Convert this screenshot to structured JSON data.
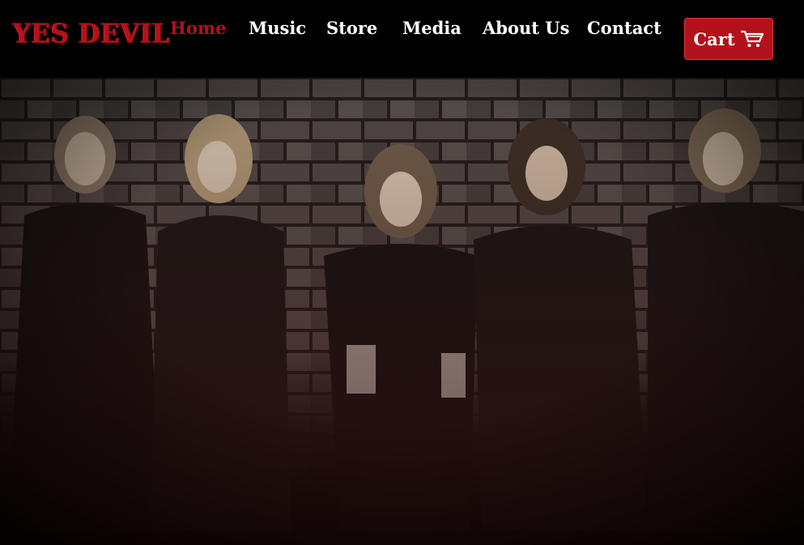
{
  "brand": {
    "name": "YES DEVIL"
  },
  "nav": {
    "items": [
      {
        "label": "Home",
        "active": true
      },
      {
        "label": "Music",
        "active": false
      },
      {
        "label": "Store",
        "active": false
      },
      {
        "label": "Media",
        "active": false
      },
      {
        "label": "About Us",
        "active": false
      },
      {
        "label": "Contact",
        "active": false
      }
    ]
  },
  "cart": {
    "label": "Cart",
    "icon": "shopping-cart-icon"
  },
  "hero": {
    "image": "band-photo-brick-wall"
  },
  "colors": {
    "accent": "#b3121b",
    "header_bg": "#000000",
    "nav_text": "#ffffff"
  }
}
